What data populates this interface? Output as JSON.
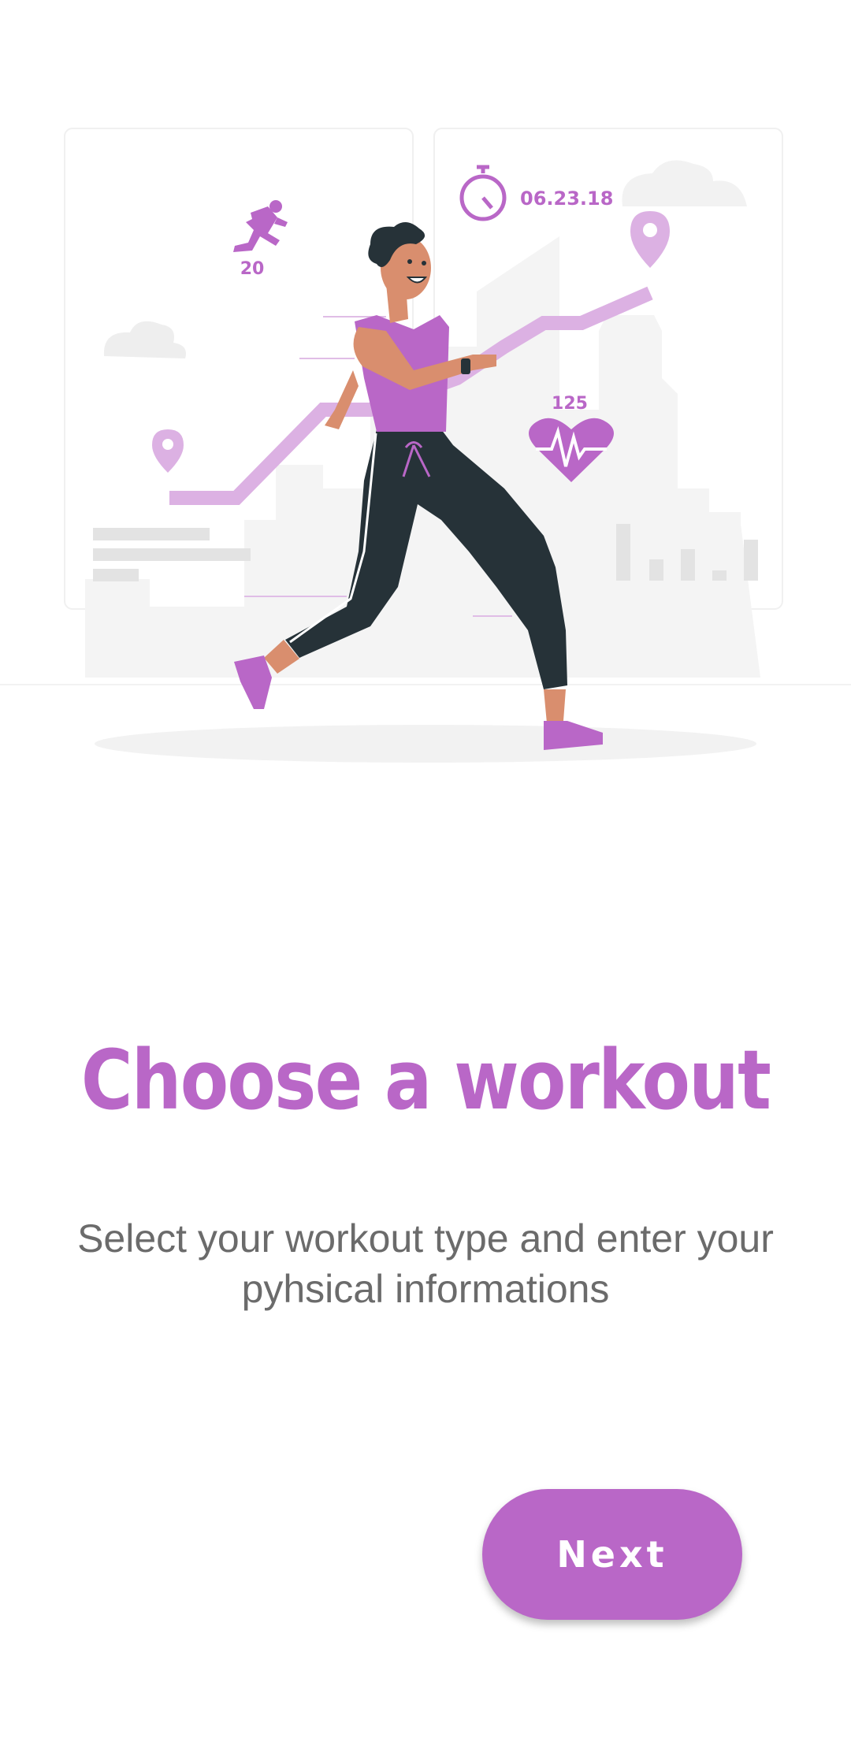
{
  "onboarding": {
    "title": "Choose a workout",
    "subtitle": "Select your workout type and enter your pyhsical informations",
    "next_label": "Next"
  },
  "illustration": {
    "runner_stat": "20",
    "date": "06.23.18",
    "heart_rate": "125"
  },
  "colors": {
    "accent": "#b967c7",
    "accent_light": "#dcb1e3",
    "subtitle_text": "#6b6b6b",
    "background": "#ffffff"
  }
}
